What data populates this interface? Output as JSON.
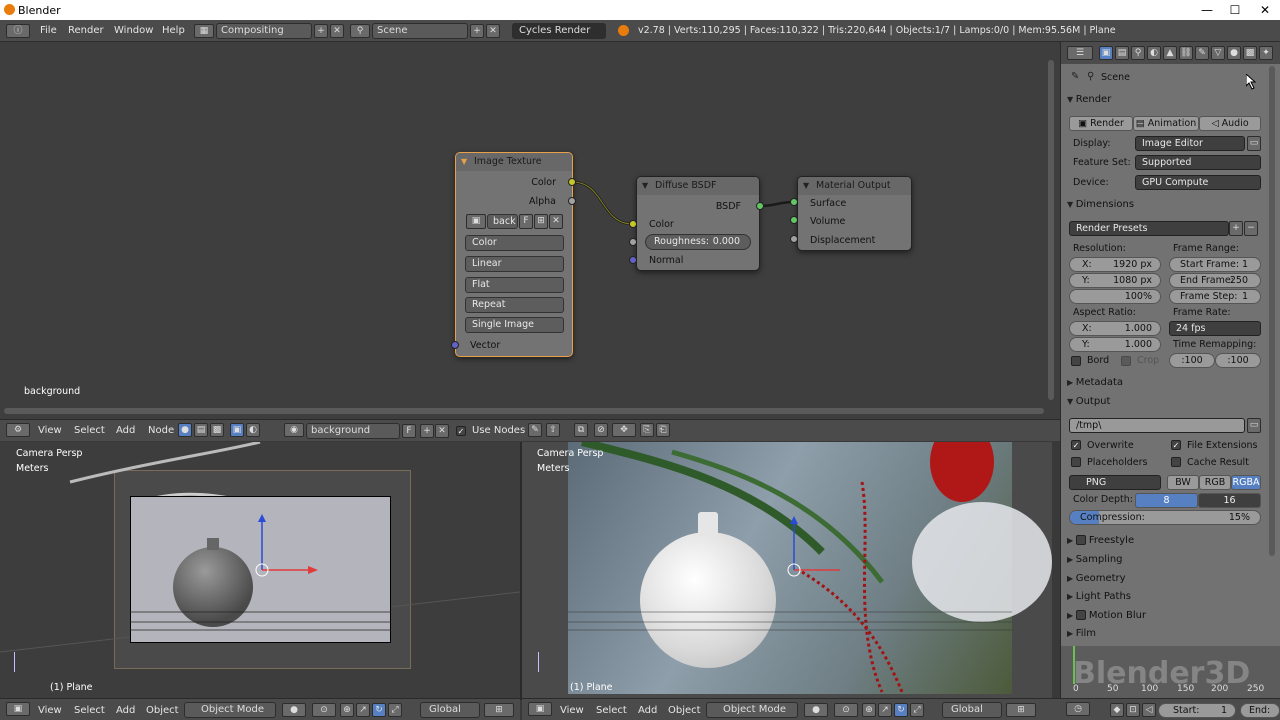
{
  "window": {
    "title": "Blender",
    "minimize": "—",
    "maximize": "☐",
    "close": "✕"
  },
  "topbar": {
    "menus": [
      "File",
      "Render",
      "Window",
      "Help"
    ],
    "screen_layout": "Compositing",
    "scene": "Scene",
    "engine": "Cycles Render",
    "stats": "v2.78 | Verts:110,295 | Faces:110,322 | Tris:220,644 | Objects:1/7 | Lamps:0/0 | Mem:95.56M | Plane"
  },
  "node_editor": {
    "label": "background",
    "nodes": {
      "image_texture": {
        "title": "Image Texture",
        "out_color": "Color",
        "out_alpha": "Alpha",
        "image_name": "back",
        "f_label": "F",
        "color_mode": "Color",
        "interpolation": "Linear",
        "projection": "Flat",
        "extension": "Repeat",
        "source": "Single Image",
        "in_vector": "Vector"
      },
      "diffuse": {
        "title": "Diffuse BSDF",
        "out_bsdf": "BSDF",
        "in_color": "Color",
        "roughness_label": "Roughness:",
        "roughness_value": "0.000",
        "in_normal": "Normal"
      },
      "output": {
        "title": "Material Output",
        "surface": "Surface",
        "volume": "Volume",
        "displacement": "Displacement"
      }
    },
    "header": {
      "menus": [
        "View",
        "Select",
        "Add",
        "Node"
      ],
      "material": "background",
      "f_label": "F",
      "use_nodes": "Use Nodes"
    }
  },
  "viewport_left": {
    "persp": "Camera Persp",
    "units": "Meters",
    "object": "(1) Plane",
    "menus": [
      "View",
      "Select",
      "Add",
      "Object"
    ],
    "mode": "Object Mode",
    "orientation": "Global"
  },
  "viewport_right": {
    "persp": "Camera Persp",
    "units": "Meters",
    "object": "(1) Plane",
    "menus": [
      "View",
      "Select",
      "Add",
      "Object"
    ],
    "mode": "Object Mode",
    "orientation": "Global"
  },
  "properties": {
    "breadcrumb": "Scene",
    "render": {
      "title": "Render",
      "buttons": [
        "Render",
        "Animation",
        "Audio"
      ],
      "display_label": "Display:",
      "display": "Image Editor",
      "feature_label": "Feature Set:",
      "feature": "Supported",
      "device_label": "Device:",
      "device": "GPU Compute"
    },
    "dimensions": {
      "title": "Dimensions",
      "presets": "Render Presets",
      "resolution_label": "Resolution:",
      "res_x_label": "X:",
      "res_x": "1920 px",
      "res_y_label": "Y:",
      "res_y": "1080 px",
      "res_pct": "100%",
      "frame_range_label": "Frame Range:",
      "start_label": "Start Frame:",
      "start": "1",
      "end_label": "End Frame:",
      "end": "250",
      "step_label": "Frame Step:",
      "step": "1",
      "aspect_label": "Aspect Ratio:",
      "asp_x_label": "X:",
      "asp_x": "1.000",
      "asp_y_label": "Y:",
      "asp_y": "1.000",
      "frame_rate_label": "Frame Rate:",
      "frame_rate": "24 fps",
      "remap_label": "Time Remapping:",
      "remap_old": ":100",
      "remap_new": ":100",
      "bord": "Bord",
      "crop": "Crop"
    },
    "metadata": "Metadata",
    "output": {
      "title": "Output",
      "path": "/tmp\\",
      "overwrite": "Overwrite",
      "file_extensions": "File Extensions",
      "placeholders": "Placeholders",
      "cache_result": "Cache Result",
      "format": "PNG",
      "bw": "BW",
      "rgb": "RGB",
      "rgba": "RGBA",
      "color_depth_label": "Color Depth:",
      "depth_8": "8",
      "depth_16": "16",
      "compression_label": "Compression:",
      "compression": "15%",
      "compression_value": 0.15
    },
    "panels": [
      "Freestyle",
      "Sampling",
      "Geometry",
      "Light Paths",
      "Motion Blur",
      "Film"
    ]
  },
  "timeline": {
    "watermark": "Blender3D",
    "ticks": [
      "0",
      "50",
      "100",
      "150",
      "200",
      "250"
    ],
    "start_label": "Start:",
    "start": "1",
    "end_label": "End:"
  },
  "colors": {
    "accent_blue": "#5680c2",
    "selected_orange": "#e8a14a",
    "socket_yellow": "#c7c729",
    "socket_green": "#63c763",
    "socket_grey": "#a1a1a1",
    "socket_purple": "#6363c7"
  }
}
